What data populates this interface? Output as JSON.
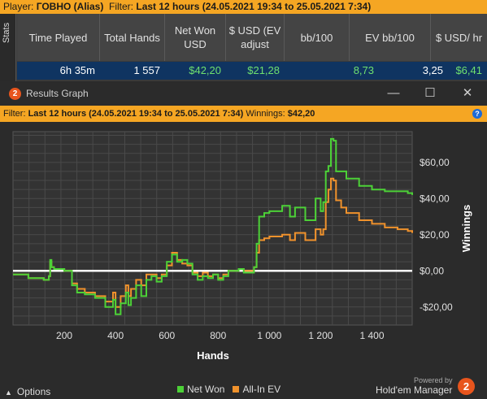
{
  "topbar": {
    "player_prefix": "Player: ",
    "player_name": "ГОВНО (Alias)",
    "filter_prefix": "Filter: ",
    "filter_text": "Last 12 hours (24.05.2021 19:34 to 25.05.2021 7:34)"
  },
  "stats": {
    "tab_label": "Stats",
    "columns": [
      "Time Played",
      "Total Hands",
      "Net Won USD",
      "$ USD (EV adjust",
      "bb/100",
      "EV bb/100",
      "$ USD/ hr"
    ],
    "row": [
      "6h 35m",
      "1 557",
      "$42,20",
      "$21,28",
      "8,73",
      "3,25",
      "$6,41"
    ]
  },
  "window": {
    "title": "Results Graph",
    "logo_text": "2",
    "controls": {
      "minimize": "—",
      "maximize": "☐",
      "close": "✕"
    },
    "filter_prefix": "Filter: ",
    "filter_text": "Last 12 hours (24.05.2021 19:34 to 25.05.2021 7:34)",
    "winnings_prefix": "  Winnings: ",
    "winnings_value": "$42,20",
    "help_label": "?"
  },
  "chart_data": {
    "type": "line",
    "xlabel": "Hands",
    "ylabel": "Winnings",
    "xlim": [
      0,
      1557
    ],
    "ylim": [
      -30,
      77
    ],
    "x_ticks": [
      "200",
      "400",
      "600",
      "800",
      "1 000",
      "1 200",
      "1 400"
    ],
    "x_tick_values": [
      200,
      400,
      600,
      800,
      1000,
      1200,
      1400
    ],
    "y_ticks": [
      "-$20,00",
      "$0,00",
      "$20,00",
      "$40,00",
      "$60,00"
    ],
    "y_tick_values": [
      -20,
      0,
      20,
      40,
      60
    ],
    "grid": true,
    "series": [
      {
        "name": "Net Won",
        "color": "#4cd137",
        "x": [
          0,
          60,
          120,
          140,
          145,
          150,
          160,
          200,
          230,
          250,
          280,
          320,
          360,
          390,
          400,
          420,
          440,
          450,
          460,
          480,
          500,
          520,
          540,
          560,
          580,
          600,
          620,
          640,
          660,
          680,
          700,
          720,
          740,
          760,
          780,
          800,
          820,
          840,
          880,
          900,
          940,
          950,
          960,
          980,
          1000,
          1050,
          1080,
          1100,
          1140,
          1180,
          1200,
          1210,
          1220,
          1230,
          1240,
          1250,
          1260,
          1280,
          1300,
          1350,
          1400,
          1450,
          1500,
          1540,
          1557
        ],
        "values": [
          -2,
          -4,
          -5,
          -3,
          6,
          2,
          1,
          0,
          -8,
          -12,
          -13,
          -15,
          -20,
          -16,
          -24,
          -18,
          -12,
          -19,
          -15,
          -8,
          -14,
          -5,
          -3,
          -6,
          -3,
          5,
          9,
          5,
          6,
          4,
          -2,
          -5,
          -3,
          -4,
          -2,
          -5,
          -3,
          0,
          1,
          -1,
          2,
          15,
          30,
          32,
          33,
          36,
          30,
          35,
          28,
          40,
          33,
          38,
          55,
          58,
          73,
          72,
          55,
          55,
          51,
          47,
          45,
          44,
          44,
          43,
          42
        ]
      },
      {
        "name": "All-In EV",
        "color": "#f0922c",
        "x": [
          0,
          60,
          120,
          140,
          145,
          150,
          160,
          200,
          230,
          250,
          280,
          320,
          360,
          390,
          400,
          420,
          440,
          450,
          460,
          480,
          500,
          520,
          540,
          560,
          580,
          600,
          620,
          640,
          660,
          680,
          700,
          720,
          740,
          760,
          780,
          800,
          820,
          840,
          880,
          900,
          940,
          950,
          960,
          980,
          1000,
          1050,
          1080,
          1100,
          1140,
          1180,
          1200,
          1210,
          1220,
          1230,
          1240,
          1250,
          1260,
          1280,
          1300,
          1350,
          1400,
          1450,
          1500,
          1540,
          1557
        ],
        "values": [
          -2,
          -4,
          -5,
          -3,
          5,
          2,
          1,
          0,
          -7,
          -10,
          -12,
          -14,
          -17,
          -12,
          -20,
          -14,
          -8,
          -14,
          -10,
          -5,
          -8,
          -2,
          -2,
          -4,
          -2,
          3,
          10,
          6,
          4,
          3,
          -1,
          -3,
          -1,
          -3,
          -2,
          -4,
          -2,
          0,
          1,
          0,
          2,
          10,
          17,
          18,
          19,
          20,
          17,
          21,
          17,
          23,
          20,
          23,
          38,
          45,
          51,
          50,
          39,
          35,
          32,
          28,
          26,
          24,
          23,
          22,
          21
        ]
      }
    ]
  },
  "footer": {
    "options_label": "Options",
    "legend": [
      {
        "label": "Net Won",
        "color": "#4cd137"
      },
      {
        "label": "All-In EV",
        "color": "#f0922c"
      }
    ],
    "powered_by": "Powered by",
    "brand": "Hold'em Manager",
    "brand_logo": "2"
  }
}
